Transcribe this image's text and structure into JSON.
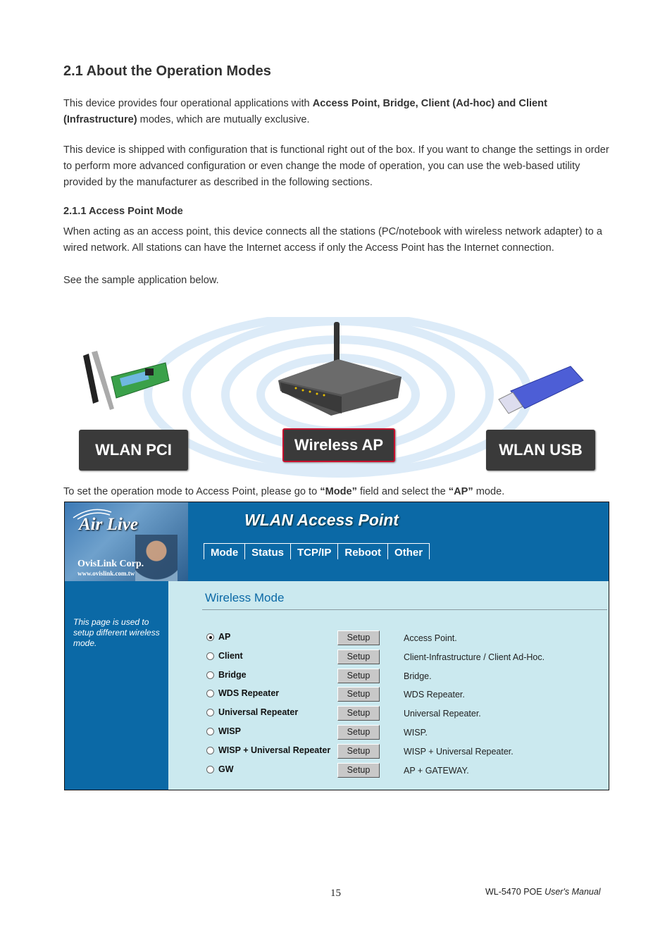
{
  "heading": "2.1 About the Operation Modes",
  "para1": {
    "pre": "This device provides four operational applications with ",
    "bold1": "Access Point, Bridge, Client (Ad-hoc) and Client",
    "bold2": "(Infrastructure)",
    "post": " modes, which are mutually exclusive."
  },
  "para2": "This device is shipped with configuration that is functional right out of the box. If you want to change the settings in order to perform more advanced configuration or even change the mode of operation, you can use the web-based utility provided by the manufacturer as described in the following sections.",
  "subheading": "2.1.1 Access Point Mode",
  "para3": "When acting as an access point, this device connects all the stations (PC/notebook with wireless network adapter) to a wired network. All stations can have the Internet access if only the Access Point has the Internet connection.",
  "para4": "See the sample application below.",
  "illustration": {
    "labels": [
      "WLAN PCI",
      "Wireless AP",
      "WLAN USB"
    ],
    "highlight_color": "#c8102e"
  },
  "instruction": {
    "pre": "To set the operation mode to Access Point, please go to ",
    "bold1": "“Mode”",
    "mid": " field and select the ",
    "bold2": "“AP”",
    "post": " mode."
  },
  "ui": {
    "brand": "Air Live",
    "corp": "OvisLink Corp.",
    "url": "www.ovislink.com.tw",
    "title": "WLAN Access Point",
    "tabs": [
      "Mode",
      "Status",
      "TCP/IP",
      "Reboot",
      "Other"
    ],
    "side_text": "This page is used to setup different wireless mode.",
    "section_title": "Wireless Mode",
    "setup_label": "Setup",
    "selected_mode": "AP",
    "modes": [
      {
        "name": "AP",
        "desc": "Access Point."
      },
      {
        "name": "Client",
        "desc": "Client-Infrastructure / Client Ad-Hoc."
      },
      {
        "name": "Bridge",
        "desc": "Bridge."
      },
      {
        "name": "WDS Repeater",
        "desc": "WDS Repeater."
      },
      {
        "name": "Universal Repeater",
        "desc": "Universal Repeater."
      },
      {
        "name": "WISP",
        "desc": "WISP."
      },
      {
        "name": "WISP + Universal Repeater",
        "desc": "WISP + Universal Repeater."
      },
      {
        "name": "GW",
        "desc": "AP + GATEWAY."
      }
    ],
    "colors": {
      "header": "#0b69a6",
      "content": "#cbe9ef"
    }
  },
  "footer": {
    "page_number": "15",
    "manual_model": "WL-5470 POE ",
    "manual_suffix": "User's Manual"
  }
}
